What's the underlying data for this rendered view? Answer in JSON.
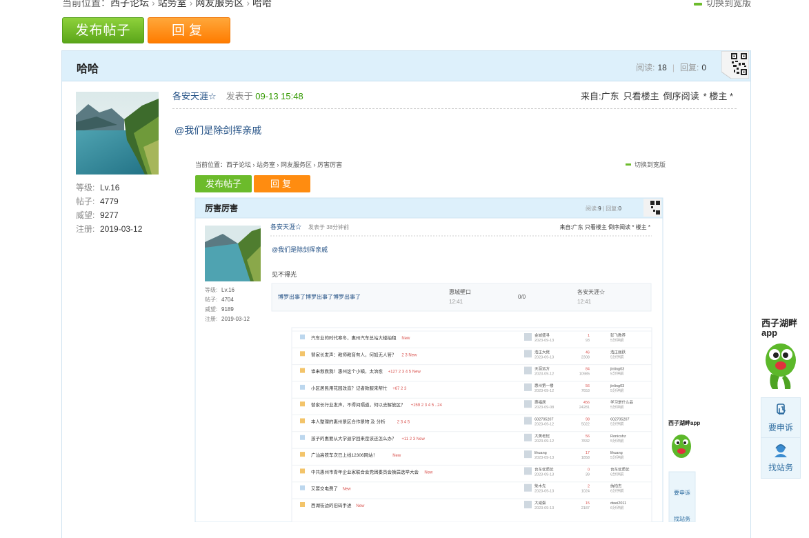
{
  "breadcrumb": {
    "prefix": "当前位置：",
    "items": [
      "西子论坛",
      "站务室",
      "网友服务区",
      "哈哈"
    ]
  },
  "toggle_wide": "切换到宽版",
  "buttons": {
    "post": "发布帖子",
    "reply": "回复"
  },
  "thread": {
    "title": "哈哈",
    "read_label": "阅读:",
    "read_count": "18",
    "reply_label": "回复:",
    "reply_count": "0",
    "divider": "|"
  },
  "user": {
    "level_label": "等级:",
    "level": "Lv.16",
    "posts_label": "帖子:",
    "posts": "4779",
    "prestige_label": "威望:",
    "prestige": "9277",
    "registered_label": "注册:",
    "registered": "2019-03-12"
  },
  "post": {
    "author": "各安天涯☆",
    "posted_label": "发表于",
    "time": "09-13 15:48",
    "location": "来自:广东",
    "only_author": "只看楼主",
    "reverse": "倒序阅读",
    "floor": "* 楼主 *",
    "mention": "@我们是除剑挥亲戚"
  },
  "embedded": {
    "crumb_prefix": "当前位置：",
    "crumb": [
      "西子论坛",
      "站务室",
      "网友服务区",
      "厉害厉害"
    ],
    "toggle_wide": "切换到宽版",
    "post_btn": "发布帖子",
    "reply_btn": "回复",
    "title": "厉害厉害",
    "read_label": "阅读:",
    "read": "9",
    "reply_label": "回复:",
    "reply": "0",
    "author": "各安天涯☆",
    "posted": "发表于 38分钟前",
    "right_meta": "来自:广东 只看楼主 倒序阅读 * 楼主 *",
    "mention": "@我们是除剑挥亲戚",
    "text": "见不得光",
    "user": {
      "level_label": "等级:",
      "level": "Lv.16",
      "posts_label": "帖子:",
      "posts": "4704",
      "prestige_label": "威望:",
      "prestige": "9189",
      "registered_label": "注册:",
      "registered": "2019-03-12"
    },
    "quote": {
      "title": "博罗出事了博罗出事了博罗出事了",
      "author": "惠城壁口",
      "time": "12:41",
      "count": "0/0",
      "last": "各安天涯☆",
      "last_time": "12:41"
    },
    "list": [
      {
        "title": "汽车业的时代寒冬，惠州汽车总站大楼拍租",
        "meta": "New",
        "user": "金城盛寻",
        "date": "2023-09-13",
        "n1": "1",
        "n2": "93",
        "last": "彭飞教养",
        "ago": "5分钟前"
      },
      {
        "title": "替家长发声：教师教育有人，何如无人管？",
        "meta": "2 3 New",
        "user": "浩正大佬",
        "date": "2023-09-13",
        "n1": "46",
        "n2": "2308",
        "last": "浩正丽跃",
        "ago": "5分钟前"
      },
      {
        "title": "谁来救救我！惠州这个小镇，太治愈",
        "meta": "+127 2 3 4 5 New",
        "user": "天涯远方",
        "date": "2023-09-12",
        "n1": "84",
        "n2": "10985",
        "last": "jinling03",
        "ago": "5分钟前"
      },
      {
        "title": "小区居民用花园改造？记者致服来帮忙",
        "meta": "+67 2 3",
        "user": "惠州第一楼",
        "date": "2023-09-12",
        "n1": "56",
        "n2": "7653",
        "last": "jinling03",
        "ago": "5分钟前"
      },
      {
        "title": "替家长行业发声，不得间隔道，何以去解放区？",
        "meta": "+159 2 3 4 5 ..24",
        "user": "惠福居",
        "date": "2023-09-08",
        "n1": "456",
        "n2": "24281",
        "last": "学习是什么品",
        "ago": "5分钟前"
      },
      {
        "title": "本人整理的惠州景区合作景物 及 分析",
        "meta": "2 3 4 5",
        "user": "602705207",
        "date": "2023-09-12",
        "n1": "98",
        "n2": "5022",
        "last": "602705207",
        "ago": "5分钟前"
      },
      {
        "title": "孩子的惠要从大学退学回来是该还怎么办？",
        "meta": "+11 2 3 New",
        "user": "大美老挝",
        "date": "2023-09-12",
        "n1": "56",
        "n2": "7832",
        "last": "Ronicshz",
        "ago": "5分钟前"
      },
      {
        "title": "广汕高铁车次已上线12306网站！",
        "meta": "New",
        "user": "lihuang",
        "date": "2023-09-13",
        "n1": "17",
        "n2": "1858",
        "last": "lihuang",
        "ago": "5分钟前"
      },
      {
        "title": "中共惠州市青年企业家联合会党团委员会换届选举大会",
        "meta": "New",
        "user": "台东优质优",
        "date": "2023-09-13",
        "n1": "0",
        "n2": "39",
        "last": "台东优质优",
        "ago": "6分钟前"
      },
      {
        "title": "又要交电费了",
        "meta": "New",
        "user": "柴木先",
        "date": "2023-09-13",
        "n1": "2",
        "n2": "1024",
        "last": "纳柏杰",
        "ago": "6分钟前"
      },
      {
        "title": "西湖街边的旧码手进",
        "meta": "New",
        "user": "大咸蛋",
        "date": "2023-09-13",
        "n1": "15",
        "n2": "2187",
        "last": "dwei2011",
        "ago": "6分钟前"
      }
    ],
    "app_label": "西子湖畔app",
    "tool1": "要申诉",
    "tool2": "找站务"
  },
  "side": {
    "app_label": "西子湖畔app",
    "tools": [
      "要申诉",
      "找站务"
    ]
  },
  "colors": {
    "green": "#6cbb2b",
    "orange": "#ff8c10",
    "header_bg": "#ddf0fb",
    "link": "#214f84",
    "time": "#339900"
  }
}
